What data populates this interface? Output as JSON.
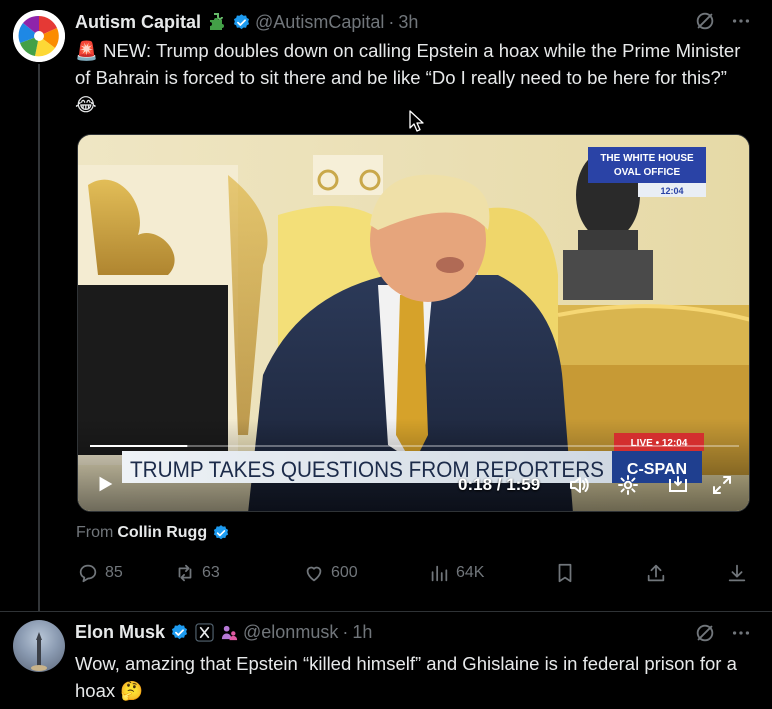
{
  "post": {
    "author": "Autism Capital",
    "handle": "@AutismCapital",
    "separator": "·",
    "time": "3h",
    "text": "🚨 NEW: Trump doubles down on calling Epstein a hoax while the Prime Minister of Bahrain is forced to sit there and be like “Do I really need to be here for this?” 😂",
    "video": {
      "bug_line1": "THE WHITE HOUSE",
      "bug_line2": "OVAL OFFICE",
      "bug_time": "12:04",
      "live_label": "LIVE • 12:04",
      "chyron": "TRUMP TAKES QUESTIONS FROM REPORTERS",
      "network": "C-SPAN",
      "timestamp": "0:18 / 1:59",
      "progress": 0.15
    },
    "from_label": "From",
    "from_name": "Collin Rugg",
    "stats": {
      "replies": "85",
      "reposts": "63",
      "likes": "600",
      "views": "64K"
    }
  },
  "reply": {
    "author": "Elon Musk",
    "handle": "@elonmusk",
    "separator": "·",
    "time": "1h",
    "text": "Wow, amazing that Epstein “killed himself” and Ghislaine is in federal prison for a hoax 🤔"
  },
  "colors": {
    "background": "#000000",
    "text": "#e7e9ea",
    "muted": "#71767b",
    "verified": "#1d9bf0",
    "divider": "#2f3336"
  }
}
